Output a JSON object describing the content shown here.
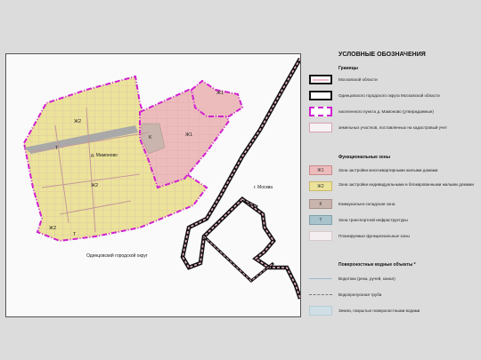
{
  "map": {
    "settlement_label": "д. Мамоново",
    "moscow_label": "г. Москва",
    "district_label": "Одинцовский городской округ",
    "zones": [
      {
        "code": "Ж2"
      },
      {
        "code": "Ж1"
      },
      {
        "code": "Ж1"
      },
      {
        "code": "К"
      },
      {
        "code": "Т"
      },
      {
        "code": "Ж2"
      },
      {
        "code": "Ж2"
      },
      {
        "code": "Т"
      }
    ]
  },
  "legend": {
    "title": "УСЛОВНЫЕ ОБОЗНАЧЕНИЯ",
    "sections": {
      "boundaries": "Границы",
      "functional": "Функциональные зоны",
      "water": "Поверхностные водные объекты *"
    },
    "boundaries": [
      "Московской области",
      "Одинцовского городского округа Московской области",
      "населенного пункта д. Мамоново (утверждаемые)",
      "земельных участков, поставленных на кадастровый учет"
    ],
    "zones": [
      {
        "code": "Ж1",
        "color": "#ecbcbc",
        "label": "Зона застройки многоквартирными жилыми домами"
      },
      {
        "code": "Ж2",
        "color": "#ece39a",
        "label": "Зона застройки индивидуальными и блокированными жилыми домами"
      },
      {
        "code": "К",
        "color": "#c9b5ad",
        "label": "Коммунально-складская зона"
      },
      {
        "code": "Т",
        "color": "#a9c3cc",
        "label": "Зона транспортной инфраструктуры"
      },
      {
        "code": "",
        "color": "#f4eef0",
        "label": "Планируемые функциональные зоны"
      }
    ],
    "water": [
      "Водотоки (река, ручей, канал)",
      "Водопропускная труба",
      "Земли, покрытые поверхностными водами"
    ]
  }
}
